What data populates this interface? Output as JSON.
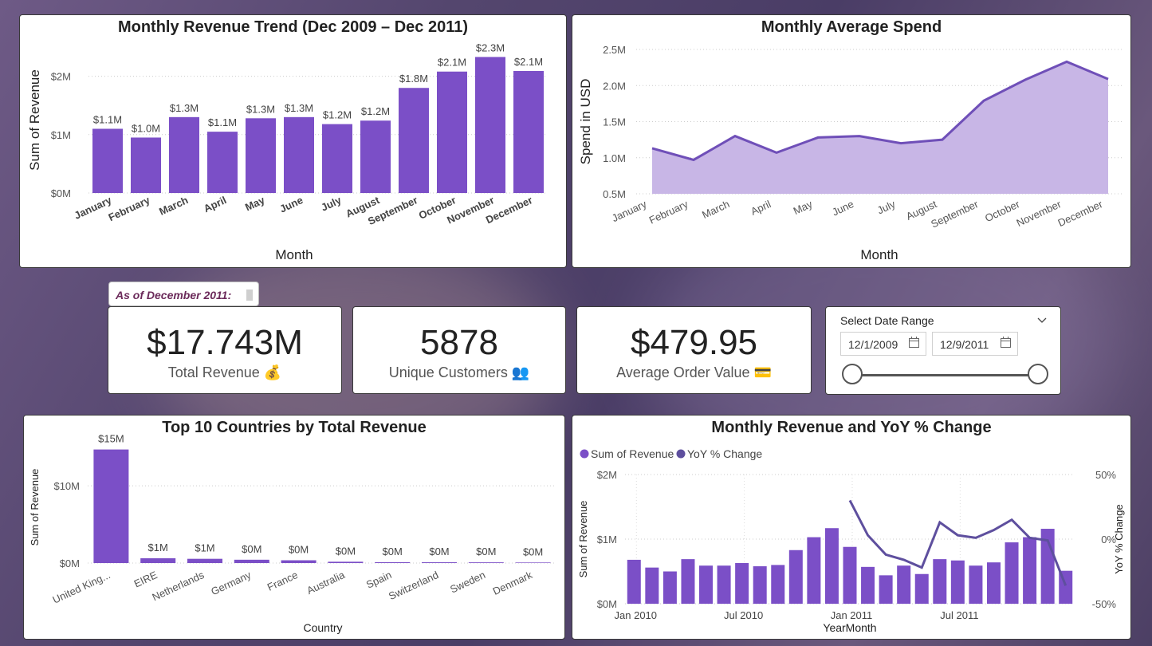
{
  "colors": {
    "accent": "#7b4fc7",
    "area": "#c8b6e6",
    "line": "#6f4fb8",
    "yoy_line": "#5e4f9e"
  },
  "chart_data": [
    {
      "type": "bar",
      "title": "Monthly Revenue Trend (Dec 2009 – Dec 2011)",
      "xlabel": "Month",
      "ylabel": "Sum of Revenue",
      "categories": [
        "January",
        "February",
        "March",
        "April",
        "May",
        "June",
        "July",
        "August",
        "September",
        "October",
        "November",
        "December"
      ],
      "values": [
        1.1,
        0.95,
        1.3,
        1.05,
        1.28,
        1.3,
        1.18,
        1.24,
        1.8,
        2.08,
        2.33,
        2.09
      ],
      "data_labels": [
        "$1.1M",
        "$1.0M",
        "$1.3M",
        "$1.1M",
        "$1.3M",
        "$1.3M",
        "$1.2M",
        "$1.2M",
        "$1.8M",
        "$2.1M",
        "$2.3M",
        "$2.1M"
      ],
      "y_ticks": [
        "$0M",
        "$1M",
        "$2M"
      ],
      "ylim": [
        0,
        2.5
      ],
      "grid": true
    },
    {
      "type": "area",
      "title": "Monthly Average Spend",
      "xlabel": "Month",
      "ylabel": "Spend in USD",
      "categories": [
        "January",
        "February",
        "March",
        "April",
        "May",
        "June",
        "July",
        "August",
        "September",
        "October",
        "November",
        "December"
      ],
      "values": [
        1.13,
        0.97,
        1.3,
        1.07,
        1.28,
        1.3,
        1.2,
        1.25,
        1.79,
        2.08,
        2.33,
        2.09
      ],
      "y_ticks": [
        "0.5M",
        "1.0M",
        "1.5M",
        "2.0M",
        "2.5M"
      ],
      "ylim": [
        0.5,
        2.5
      ],
      "grid": true
    },
    {
      "type": "bar",
      "title": "Top 10 Countries by Total Revenue",
      "xlabel": "Country",
      "ylabel": "Sum of Revenue",
      "categories": [
        "United King...",
        "EIRE",
        "Netherlands",
        "Germany",
        "France",
        "Australia",
        "Spain",
        "Switzerland",
        "Sweden",
        "Denmark"
      ],
      "values": [
        14.7,
        0.62,
        0.55,
        0.43,
        0.36,
        0.17,
        0.11,
        0.1,
        0.09,
        0.07
      ],
      "data_labels": [
        "$15M",
        "$1M",
        "$1M",
        "$0M",
        "$0M",
        "$0M",
        "$0M",
        "$0M",
        "$0M",
        "$0M"
      ],
      "y_ticks": [
        "$0M",
        "$10M"
      ],
      "ylim": [
        0,
        16
      ],
      "grid": true
    },
    {
      "type": "bar",
      "title": "Monthly Revenue and YoY % Change",
      "xlabel": "YearMonth",
      "ylabel": "Sum of Revenue",
      "y2label": "YoY % Change",
      "series": [
        {
          "name": "Sum of Revenue",
          "values": [
            0.68,
            0.56,
            0.5,
            0.69,
            0.59,
            0.59,
            0.63,
            0.58,
            0.6,
            0.83,
            1.03,
            1.17,
            0.88,
            0.57,
            0.44,
            0.59,
            0.46,
            0.69,
            0.67,
            0.59,
            0.64,
            0.95,
            1.03,
            1.16,
            0.51
          ]
        },
        {
          "name": "YoY % Change",
          "values": [
            null,
            null,
            null,
            null,
            null,
            null,
            null,
            null,
            null,
            null,
            null,
            null,
            30,
            3,
            -12,
            -16,
            -22,
            13,
            3,
            1,
            7,
            15,
            1,
            -1,
            -36
          ]
        }
      ],
      "x_ticks": [
        "Jan 2010",
        "Jul 2010",
        "Jan 2011",
        "Jul 2011"
      ],
      "y_ticks": [
        "$0M",
        "$1M",
        "$2M"
      ],
      "y2_ticks": [
        "-50%",
        "0%",
        "50%"
      ],
      "ylim": [
        0,
        2
      ],
      "y2lim": [
        -50,
        50
      ],
      "legend": "top-left",
      "grid": true
    }
  ],
  "kpis": [
    {
      "value": "$17.743M",
      "label": "Total Revenue"
    },
    {
      "value": "5878",
      "label": "Unique Customers"
    },
    {
      "value": "$479.95",
      "label": "Average Order Value"
    }
  ],
  "asof": {
    "label": "As of December 2011:"
  },
  "slicer": {
    "title": "Select Date Range",
    "start": "12/1/2009",
    "end": "12/9/2011",
    "start_fraction": 0,
    "end_fraction": 1
  }
}
